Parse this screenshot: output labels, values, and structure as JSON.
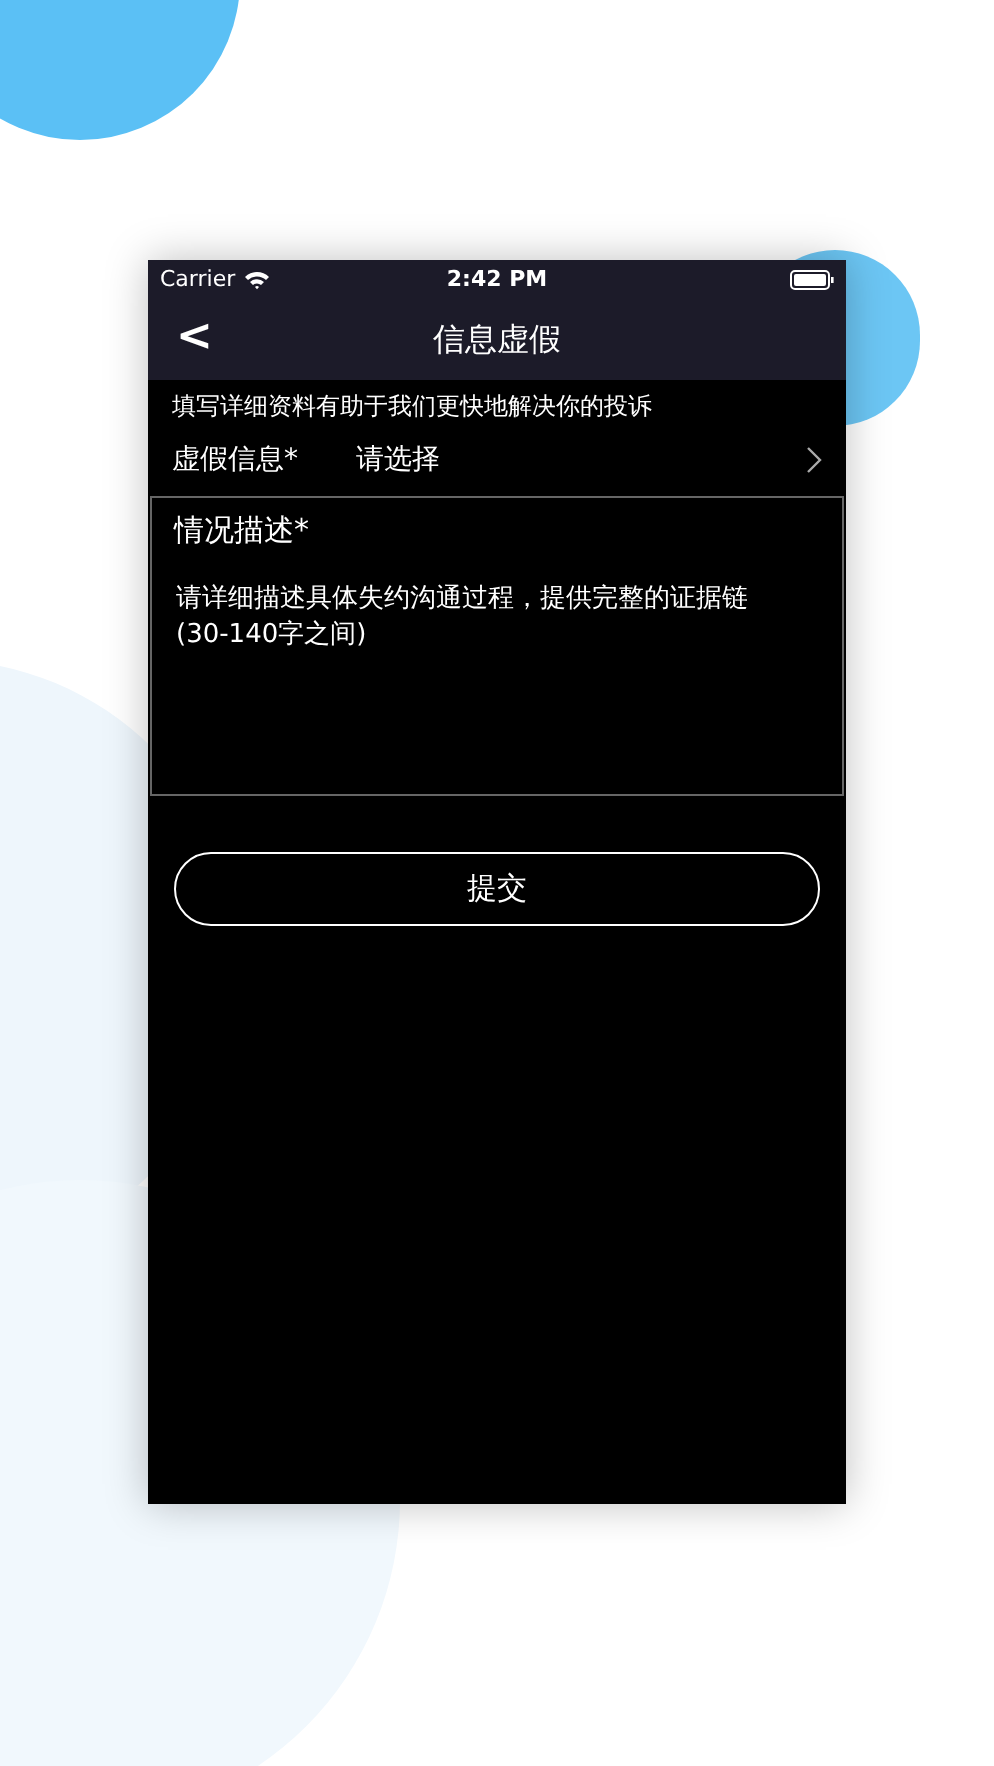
{
  "status_bar": {
    "carrier": "Carrier",
    "time": "2:42 PM"
  },
  "nav": {
    "back": "<",
    "title": "信息虚假"
  },
  "hint": "填写详细资料有助于我们更快地解决你的投诉",
  "picker": {
    "label": "虚假信息*",
    "placeholder": "请选择"
  },
  "description": {
    "label": "情况描述*",
    "placeholder": "请详细描述具体失约沟通过程，提供完整的证据链\n(30-140字之间)"
  },
  "submit": "提交"
}
